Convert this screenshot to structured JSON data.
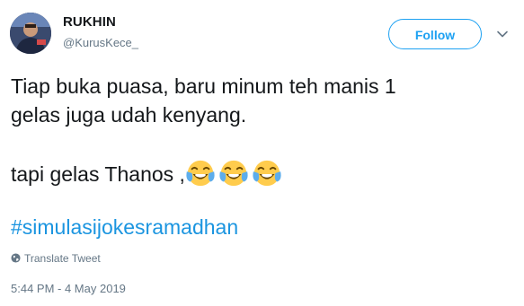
{
  "author": {
    "name": "RUKHIN",
    "handle": "@KurusKece_"
  },
  "actions": {
    "follow_label": "Follow",
    "caret_icon": "chevron-down-icon"
  },
  "tweet": {
    "line1": "Tiap buka puasa, baru minum teh manis 1",
    "line2": "gelas juga udah kenyang.",
    "line3": "tapi gelas Thanos ,",
    "emojis": [
      "face-with-tears-of-joy",
      "face-with-tears-of-joy",
      "face-with-tears-of-joy"
    ],
    "hashtag": "#simulasijokesramadhan"
  },
  "footer": {
    "translate_label": "Translate Tweet",
    "translate_icon": "globe-icon",
    "timestamp": "5:44 PM - 4 May 2019"
  },
  "colors": {
    "accent": "#1da1f2",
    "link": "#1b95e0",
    "muted": "#657786",
    "text": "#14171a"
  }
}
